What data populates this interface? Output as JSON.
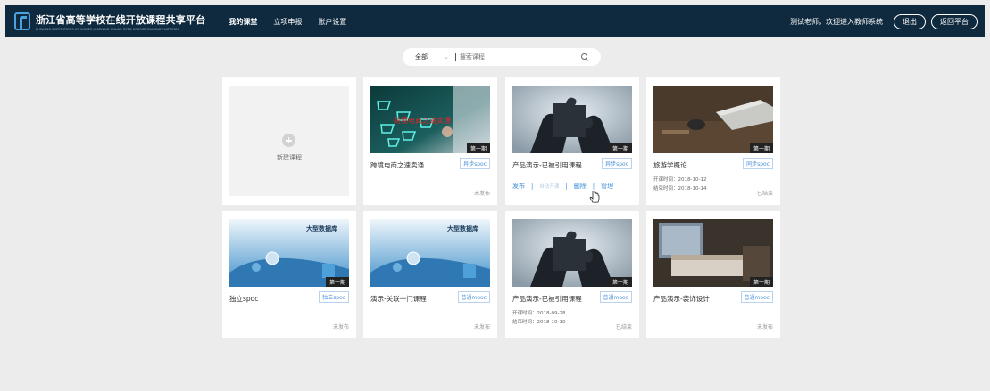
{
  "header": {
    "logo_title": "浙江省高等学校在线开放课程共享平台",
    "logo_subtitle": "ZHEJIANG INSTITUTIONS OF HIGHER LEARNING ONLINE OPEN COURSE SHARING PLATFORM",
    "nav": [
      "我的课堂",
      "立项申报",
      "账户设置"
    ],
    "welcome": "测试老师，欢迎进入教师系统",
    "logout": "退出",
    "back_platform": "返回平台"
  },
  "search": {
    "scope": "全部",
    "placeholder": "搜索课程"
  },
  "new_course": {
    "label": "新建课程"
  },
  "cards": [
    {
      "title": "跨境电商之速卖通",
      "tag": "异步spoc",
      "status": "未发布",
      "period": "第一期",
      "image_text": "跨境电商之速卖通"
    },
    {
      "title": "产品演示-已被引用课程",
      "tag": "异步spoc",
      "period": "第一期",
      "actions": {
        "publish": "发布",
        "open_setting": "自动开课",
        "delete": "删除",
        "manage": "管理"
      }
    },
    {
      "title": "旅游学概论",
      "tag": "同步spoc",
      "status": "已结束",
      "period": "第一期",
      "start_label": "开课时间：2018-10-12",
      "end_label": "结束时间：2018-10-14"
    },
    {
      "title": "独立spoc",
      "tag": "独立spoc",
      "status": "未发布",
      "period": "第一期",
      "image_text": "大型数据库"
    },
    {
      "title": "演示-关联一门课程",
      "tag": "普通mooc",
      "status": "未发布",
      "image_text": "大型数据库"
    },
    {
      "title": "产品演示-已被引用课程",
      "tag": "普通mooc",
      "status": "已结束",
      "period": "第一期",
      "start_label": "开课时间：2018-09-28",
      "end_label": "结束时间：2018-10-10"
    },
    {
      "title": "产品演示-装饰设计",
      "tag": "普通mooc",
      "status": "未发布",
      "period": "第一期"
    }
  ],
  "colors": {
    "header_bg": "#0f2a3e",
    "accent": "#3d8fd6",
    "page_bg": "#ececec"
  }
}
